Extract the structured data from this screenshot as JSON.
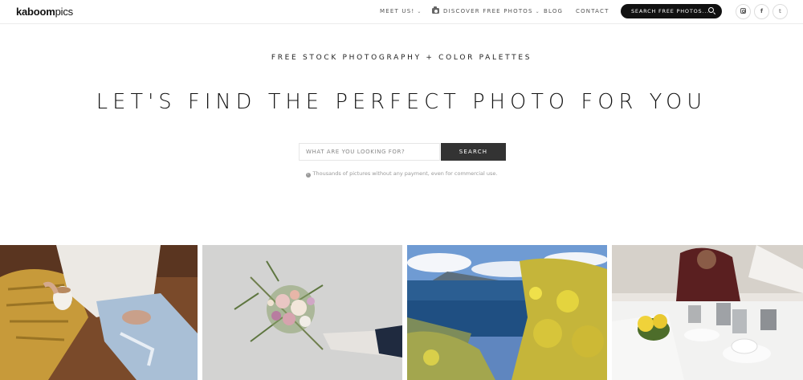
{
  "brand": {
    "bold": "kaboom",
    "light": "pics"
  },
  "nav": {
    "meet_us": "MEET US!",
    "discover": "DISCOVER FREE PHOTOS",
    "blog": "BLOG",
    "contact": "CONTACT",
    "chevron": "⌄"
  },
  "top_search": {
    "label": "SEARCH FREE PHOTOS..."
  },
  "social": {
    "facebook": "f",
    "twitter": "𝕥"
  },
  "hero": {
    "eyebrow": "FREE STOCK PHOTOGRAPHY + COLOR PALETTES",
    "headline": "LET'S FIND THE PERFECT PHOTO FOR YOU",
    "search_placeholder": "WHAT ARE YOU LOOKING FOR?",
    "search_button": "SEARCH",
    "note_icon": "i",
    "note": "Thousands of pictures without any payment, even for commercial use."
  },
  "icons": {
    "camera": "camera-icon",
    "search": "search-icon",
    "instagram": "instagram-icon",
    "facebook": "facebook-icon",
    "twitter": "twitter-icon",
    "info": "info-icon"
  },
  "colors": {
    "header_pill": "#111111",
    "search_button": "#333333",
    "text": "#222222"
  }
}
